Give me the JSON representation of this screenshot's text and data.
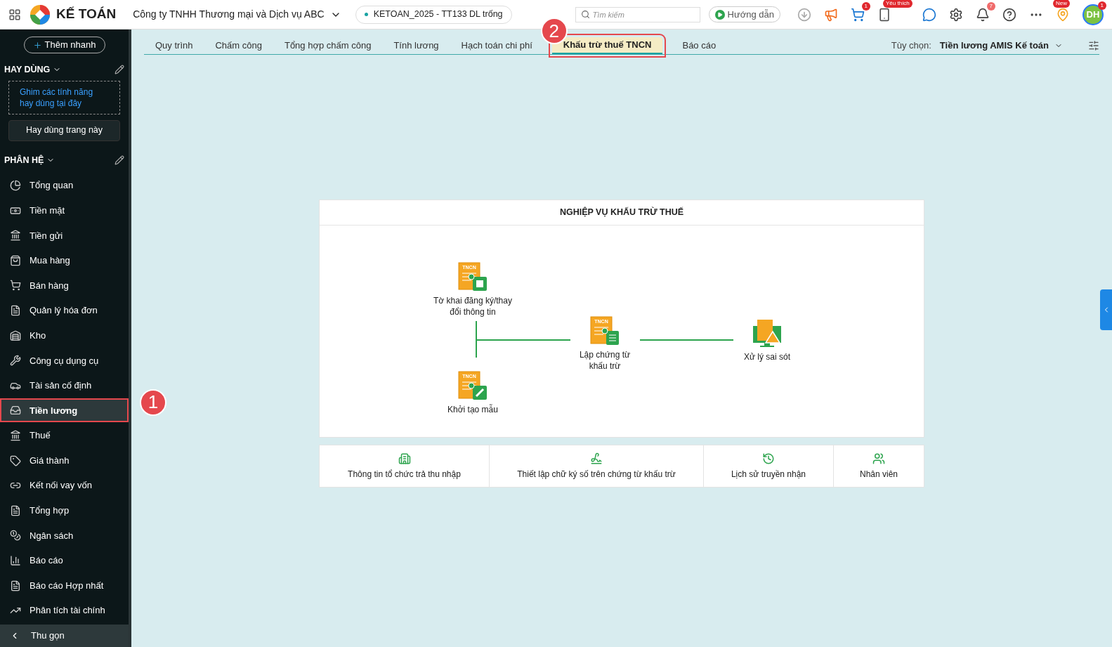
{
  "app": {
    "name": "KẾ TOÁN",
    "company": "Công ty TNHH Thương mại và Dịch vụ ABC",
    "database": "KETOAN_2025 - TT133 DL trống"
  },
  "topbar": {
    "search_placeholder": "Tìm kiếm",
    "guide_button": "Hướng dẫn",
    "cart_badge": "1",
    "favorite_badge": "Yêu thích",
    "bell_badge": "7",
    "new_badge": "New",
    "avatar": "DH",
    "avatar_badge": "1"
  },
  "sidebar": {
    "quick_add": "Thêm nhanh",
    "favorites_title": "HAY DÙNG",
    "favorites_hint": "Ghim các tính năng hay dùng tại đây",
    "favorites_button": "Hay dùng trang này",
    "modules_title": "PHÂN HỆ",
    "items": [
      {
        "label": "Tổng quan",
        "selected": false
      },
      {
        "label": "Tiền mặt",
        "selected": false
      },
      {
        "label": "Tiền gửi",
        "selected": false
      },
      {
        "label": "Mua hàng",
        "selected": false
      },
      {
        "label": "Bán hàng",
        "selected": false
      },
      {
        "label": "Quản lý hóa đơn",
        "selected": false
      },
      {
        "label": "Kho",
        "selected": false
      },
      {
        "label": "Công cụ dụng cụ",
        "selected": false
      },
      {
        "label": "Tài sản cố định",
        "selected": false
      },
      {
        "label": "Tiền lương",
        "selected": true,
        "callout": "1"
      },
      {
        "label": "Thuế",
        "selected": false
      },
      {
        "label": "Giá thành",
        "selected": false
      },
      {
        "label": "Kết nối vay vốn",
        "selected": false
      },
      {
        "label": "Tổng hợp",
        "selected": false
      },
      {
        "label": "Ngân sách",
        "selected": false
      },
      {
        "label": "Báo cáo",
        "selected": false
      },
      {
        "label": "Báo cáo Hợp nhất",
        "selected": false
      },
      {
        "label": "Phân tích tài chính",
        "selected": false
      }
    ],
    "collapse": "Thu gọn"
  },
  "tabs": [
    {
      "label": "Quy trình",
      "selected": false
    },
    {
      "label": "Chấm công",
      "selected": false
    },
    {
      "label": "Tổng hợp chấm công",
      "selected": false
    },
    {
      "label": "Tính lương",
      "selected": false
    },
    {
      "label": "Hạch toán chi phí",
      "selected": false
    },
    {
      "label": "Khấu trừ thuế TNCN",
      "selected": true,
      "callout": "2"
    },
    {
      "label": "Báo cáo",
      "selected": false
    }
  ],
  "options": {
    "label": "Tùy chọn:",
    "value": "Tiền lương AMIS Kế toán"
  },
  "process": {
    "title": "NGHIỆP VỤ KHẤU TRỪ THUẾ",
    "nodes": [
      {
        "label": "Tờ khai đăng ký/thay đổi thông tin",
        "icon_text": "TNCN",
        "kind": "register"
      },
      {
        "label": "Lập chứng từ khấu trừ",
        "icon_text": "TNCN",
        "kind": "voucher"
      },
      {
        "label": "Xử lý sai sót",
        "kind": "error"
      },
      {
        "label": "Khởi tạo mẫu",
        "icon_text": "TNCN",
        "kind": "template"
      }
    ]
  },
  "links": [
    {
      "label": "Thông tin tổ chức trả thu nhập"
    },
    {
      "label": "Thiết lập chữ ký số trên chứng từ khấu trừ"
    },
    {
      "label": "Lịch sử truyền nhận"
    },
    {
      "label": "Nhân viên"
    }
  ]
}
